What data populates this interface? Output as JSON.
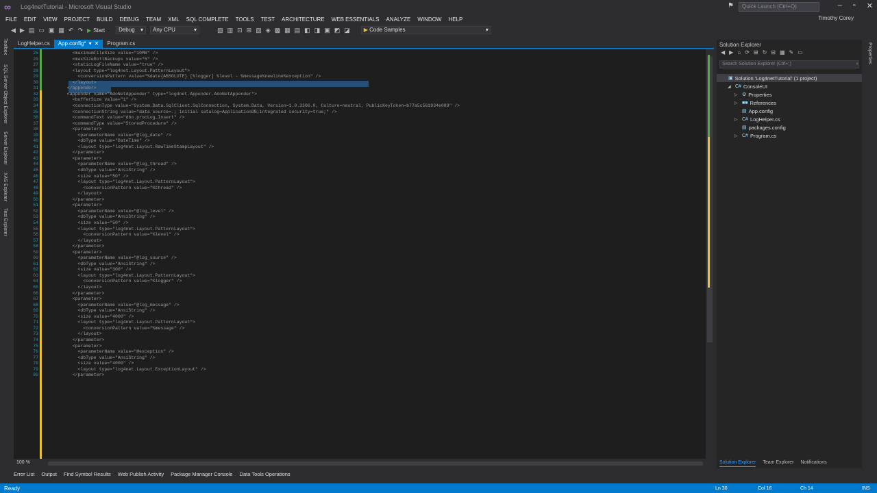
{
  "window": {
    "title": "Log4netTutorial - Microsoft Visual Studio",
    "quick_launch_placeholder": "Quick Launch (Ctrl+Q)",
    "user": "Timothy Corey"
  },
  "menu": [
    "FILE",
    "EDIT",
    "VIEW",
    "PROJECT",
    "BUILD",
    "DEBUG",
    "TEAM",
    "XML",
    "SQL COMPLETE",
    "TOOLS",
    "TEST",
    "ARCHITECTURE",
    "WEB ESSENTIALS",
    "ANALYZE",
    "WINDOW",
    "HELP"
  ],
  "toolbar": {
    "start_label": "Start",
    "config": "Debug",
    "platform": "Any CPU",
    "code_samples": "Code Samples"
  },
  "left_strip": [
    "Toolbox",
    "SQL Server Object Explorer",
    "Server Explorer",
    "XAS Explorer",
    "Test Explorer"
  ],
  "tabs": [
    {
      "label": "LogHelper.cs",
      "active": false
    },
    {
      "label": "App.config*",
      "active": true
    },
    {
      "label": "Program.cs",
      "active": false
    }
  ],
  "code_lines": [
    {
      "n": "25",
      "t": "    <maximumFileSize value=\"10MB\" />"
    },
    {
      "n": "26",
      "t": "    <maxSizeRollBackups value=\"5\" />"
    },
    {
      "n": "27",
      "t": "    <staticLogFileName value=\"true\" />"
    },
    {
      "n": "28",
      "t": "    <layout type=\"log4net.Layout.PatternLayout\">"
    },
    {
      "n": "29",
      "t": "      <conversionPattern value=\"%date{ABSOLUTE} [%logger] %level - %message%newline%exception\" />"
    },
    {
      "n": "30",
      "t": "    </layout>"
    },
    {
      "n": "31",
      "t": "  </appender>"
    },
    {
      "n": "32",
      "t": "  <appender name=\"AdoNetAppender\" type=\"log4net.Appender.AdoNetAppender\">"
    },
    {
      "n": "33",
      "t": "    <bufferSize value=\"1\" />"
    },
    {
      "n": "34",
      "t": "    <connectionType value=\"System.Data.SqlClient.SqlConnection, System.Data, Version=1.0.3300.0, Culture=neutral, PublicKeyToken=b77a5c561934e089\" />"
    },
    {
      "n": "35",
      "t": "    <connectionString value=\"data source=.; initial catalog=ApplicationDB;integrated security=true;\" />"
    },
    {
      "n": "36",
      "t": "    <commandText value=\"dbo.procLog_Insert\" />"
    },
    {
      "n": "37",
      "t": "    <commandType value=\"StoredProcedure\" />"
    },
    {
      "n": "38",
      "t": "    <parameter>"
    },
    {
      "n": "39",
      "t": "      <parameterName value=\"@log_date\" />"
    },
    {
      "n": "40",
      "t": "      <dbType value=\"DateTime\" />"
    },
    {
      "n": "41",
      "t": "      <layout type=\"log4net.Layout.RawTimeStampLayout\" />"
    },
    {
      "n": "42",
      "t": "    </parameter>"
    },
    {
      "n": "43",
      "t": "    <parameter>"
    },
    {
      "n": "44",
      "t": "      <parameterName value=\"@log_thread\" />"
    },
    {
      "n": "45",
      "t": "      <dbType value=\"AnsiString\" />"
    },
    {
      "n": "46",
      "t": "      <size value=\"50\" />"
    },
    {
      "n": "47",
      "t": "      <layout type=\"log4net.Layout.PatternLayout\">"
    },
    {
      "n": "48",
      "t": "        <conversionPattern value=\"%thread\" />"
    },
    {
      "n": "49",
      "t": "      </layout>"
    },
    {
      "n": "50",
      "t": "    </parameter>"
    },
    {
      "n": "51",
      "t": "    <parameter>"
    },
    {
      "n": "52",
      "t": "      <parameterName value=\"@log_level\" />"
    },
    {
      "n": "53",
      "t": "      <dbType value=\"AnsiString\" />"
    },
    {
      "n": "54",
      "t": "      <size value=\"50\" />"
    },
    {
      "n": "55",
      "t": "      <layout type=\"log4net.Layout.PatternLayout\">"
    },
    {
      "n": "56",
      "t": "        <conversionPattern value=\"%level\" />"
    },
    {
      "n": "57",
      "t": "      </layout>"
    },
    {
      "n": "58",
      "t": "    </parameter>"
    },
    {
      "n": "59",
      "t": "    <parameter>"
    },
    {
      "n": "60",
      "t": "      <parameterName value=\"@log_source\" />"
    },
    {
      "n": "61",
      "t": "      <dbType value=\"AnsiString\" />"
    },
    {
      "n": "62",
      "t": "      <size value=\"300\" />"
    },
    {
      "n": "63",
      "t": "      <layout type=\"log4net.Layout.PatternLayout\">"
    },
    {
      "n": "64",
      "t": "        <conversionPattern value=\"%logger\" />"
    },
    {
      "n": "65",
      "t": "      </layout>"
    },
    {
      "n": "66",
      "t": "    </parameter>"
    },
    {
      "n": "67",
      "t": "    <parameter>"
    },
    {
      "n": "68",
      "t": "      <parameterName value=\"@log_message\" />"
    },
    {
      "n": "69",
      "t": "      <dbType value=\"AnsiString\" />"
    },
    {
      "n": "70",
      "t": "      <size value=\"4000\" />"
    },
    {
      "n": "71",
      "t": "      <layout type=\"log4net.Layout.PatternLayout\">"
    },
    {
      "n": "72",
      "t": "        <conversionPattern value=\"%message\" />"
    },
    {
      "n": "73",
      "t": "      </layout>"
    },
    {
      "n": "74",
      "t": "    </parameter>"
    },
    {
      "n": "75",
      "t": "    <parameter>"
    },
    {
      "n": "76",
      "t": "      <parameterName value=\"@exception\" />"
    },
    {
      "n": "77",
      "t": "      <dbType value=\"AnsiString\" />"
    },
    {
      "n": "78",
      "t": "      <size value=\"4000\" />"
    },
    {
      "n": "79",
      "t": "      <layout type=\"log4net.Layout.ExceptionLayout\" />"
    },
    {
      "n": "80",
      "t": "    </parameter>"
    }
  ],
  "zoom": "100 %",
  "solution_explorer": {
    "title": "Solution Explorer",
    "search_placeholder": "Search Solution Explorer (Ctrl+;)",
    "tree": [
      {
        "label": "Solution 'Log4netTutorial' (1 project)",
        "level": 0,
        "arrow": "",
        "icon": "▣",
        "sel": true
      },
      {
        "label": "ConsoleUI",
        "level": 1,
        "arrow": "◢",
        "icon": "C#",
        "sel": false
      },
      {
        "label": "Properties",
        "level": 2,
        "arrow": "▷",
        "icon": "⚙",
        "sel": false
      },
      {
        "label": "References",
        "level": 2,
        "arrow": "▷",
        "icon": "■■",
        "sel": false
      },
      {
        "label": "App.config",
        "level": 2,
        "arrow": "",
        "icon": "▤",
        "sel": false
      },
      {
        "label": "LogHelper.cs",
        "level": 2,
        "arrow": "▷",
        "icon": "C#",
        "sel": false
      },
      {
        "label": "packages.config",
        "level": 2,
        "arrow": "",
        "icon": "▤",
        "sel": false
      },
      {
        "label": "Program.cs",
        "level": 2,
        "arrow": "▷",
        "icon": "C#",
        "sel": false
      }
    ],
    "bottom_tabs": [
      "Solution Explorer",
      "Team Explorer",
      "Notifications"
    ]
  },
  "bottom_tabs": [
    "Error List",
    "Output",
    "Find Symbol Results",
    "Web Publish Activity",
    "Package Manager Console",
    "Data Tools Operations"
  ],
  "status": {
    "ready": "Ready",
    "ln": "Ln 30",
    "col": "Col 16",
    "ch": "Ch 14",
    "ins": "INS"
  }
}
